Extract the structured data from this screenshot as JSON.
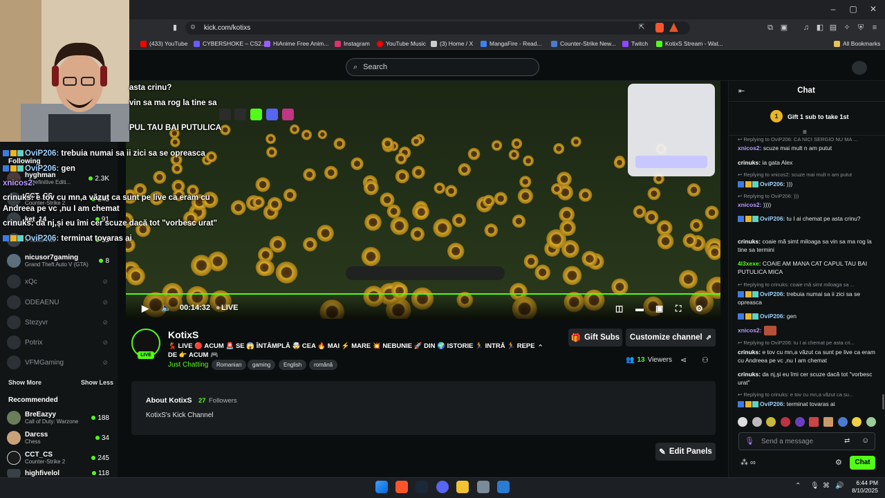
{
  "browser": {
    "url": "kick.com/kotixs",
    "bookmarks": [
      {
        "label": "(433) YouTube",
        "color": "#ff0000"
      },
      {
        "label": "CYBERSHOKE – CS2...",
        "color": "#6a5cff"
      },
      {
        "label": "HiAnime Free Anim...",
        "color": "#9b5cff"
      },
      {
        "label": "Instagram",
        "color": "#e1306c"
      },
      {
        "label": "YouTube Music",
        "color": "#ff0000"
      },
      {
        "label": "(3) Home / X",
        "color": "#cccccc"
      },
      {
        "label": "MangaFire - Read...",
        "color": "#3b82f6"
      },
      {
        "label": "Counter-Strike New...",
        "color": "#4a7bd1"
      },
      {
        "label": "Twitch",
        "color": "#9146ff"
      },
      {
        "label": "KotixS Stream - Wat...",
        "color": "#53fc18"
      }
    ],
    "all_bookmarks": "All Bookmarks"
  },
  "kick": {
    "search_placeholder": "Search"
  },
  "sidebar": {
    "following_label": "Following",
    "following": [
      {
        "name": "hyghman",
        "game": "... Definitive Editi...",
        "count": "2.3K",
        "live": true
      },
      {
        "name": "CCT_CS",
        "game": "Counter-Strike 2",
        "count": "245",
        "live": true
      },
      {
        "name": "ket_14",
        "game": "",
        "count": "91",
        "live": true
      },
      {
        "name": "",
        "game": "It Takes Two",
        "count": "53",
        "live": true
      },
      {
        "name": "nicusor7gaming",
        "game": "Grand Theft Auto V (GTA)",
        "count": "8",
        "live": true
      },
      {
        "name": "xQc",
        "game": "",
        "count": "",
        "live": false
      },
      {
        "name": "ODEAENU",
        "game": "",
        "count": "",
        "live": false
      },
      {
        "name": "Stezyvr",
        "game": "",
        "count": "",
        "live": false
      },
      {
        "name": "Potrix",
        "game": "",
        "count": "",
        "live": false
      },
      {
        "name": "VFMGaming",
        "game": "",
        "count": "",
        "live": false
      }
    ],
    "show_more": "Show More",
    "show_less": "Show Less",
    "recommended_label": "Recommended",
    "recommended": [
      {
        "name": "BreEazyy",
        "game": "Call of Duty: Warzone",
        "count": "188"
      },
      {
        "name": "Darcss",
        "game": "Chess",
        "count": "34"
      },
      {
        "name": "CCT_CS",
        "game": "Counter-Strike 2",
        "count": "245"
      },
      {
        "name": "highfivelol",
        "game": "",
        "count": "118"
      }
    ]
  },
  "overlay_chat": [
    {
      "user": "",
      "text": "asta crinu?"
    },
    {
      "user": "",
      "text": "vin sa ma rog la tine sa"
    },
    {
      "user": "",
      "text": "PUL TAU BAI PUTULICA"
    },
    {
      "user": "OviP206:",
      "text": " trebuia numai sa ii zici sa se opreasca"
    },
    {
      "user": "OviP206:",
      "text": " gen"
    },
    {
      "user": "xnicos2:",
      "text": ""
    },
    {
      "user": "crinuks:",
      "text": " e tov cu mn,a văzut ca sunt pe live ca eram cu"
    },
    {
      "user": "",
      "text": "Andreea pe vc ,nu I am chemat"
    },
    {
      "user": "crinuks:",
      "text": " da nj,și eu îmi cer scuze dacă tot \"vorbesc urat\""
    },
    {
      "user": "OviP206:",
      "text": " terminat tovaras ai"
    }
  ],
  "player": {
    "time": "00:14:32",
    "live_label": "LIVE",
    "progress": 1.0
  },
  "stream": {
    "streamer": "KotixS",
    "live_badge": "LIVE",
    "title": "💃 LIVE 🔴 ACUM 🚨 SE 😱 ÎNTÂMPLĂ 🤯 CEA 🔥 MAI ⚡ MARE 💥 NEBUNIE 🚀 DIN 🌍 ISTORIE 🏃 INTRĂ 🏃 REPE DE 👉 ACUM 🎮",
    "category": "Just Chatting",
    "tags": [
      "Romanian",
      "gaming",
      "English",
      "română"
    ],
    "gift_subs": "Gift Subs",
    "customize": "Customize channel",
    "viewers_count": "13",
    "viewers_label": "Viewers",
    "about_title": "About KotixS",
    "followers_count": "27",
    "followers_label": "Followers",
    "about_text": "KotixS's Kick Channel",
    "edit_panels": "Edit Panels"
  },
  "chat": {
    "title": "Chat",
    "gift_banner": "Gift 1 sub to take 1st",
    "gift_rank": "1",
    "messages": [
      {
        "reply": "Replying to OviP206: CA NICI SERGIO NU MA ...",
        "user": "xnicos2:",
        "user_color": "#b89cff",
        "badges": false,
        "text": " scuze mai mult n am putut"
      },
      {
        "reply": "",
        "user": "crinuks:",
        "user_color": "#ffffff",
        "badges": false,
        "text": " ia gata Alex"
      },
      {
        "reply": "Replying to xnicos2: scuze mai mult n am putut",
        "user": "OviP206:",
        "user_color": "#9fd3ff",
        "badges": true,
        "text": " )))"
      },
      {
        "reply": "Replying to OviP206: )))",
        "user": "xnicos2:",
        "user_color": "#b89cff",
        "badges": false,
        "text": " ))))"
      },
      {
        "reply": "",
        "user": "OviP206:",
        "user_color": "#9fd3ff",
        "badges": true,
        "text": " tu I ai chemat pe asta crinu?"
      },
      {
        "reply": "",
        "user": "crinuks:",
        "user_color": "#ffffff",
        "badges": false,
        "text": " coaie mă simt miloaga sa vin sa ma rog la tine sa termini"
      },
      {
        "reply": "",
        "user": "4l3xexe:",
        "user_color": "#53fc18",
        "badges": false,
        "text": " COAIE AM MANA CAT CAPUL TAU BAI PUTULICA MICA"
      },
      {
        "reply": "Replying to crinuks: coaie mă simt miloaga sa ...",
        "user": "OviP206:",
        "user_color": "#9fd3ff",
        "badges": true,
        "text": " trebuia numai sa ii zici sa se opreasca"
      },
      {
        "reply": "",
        "user": "OviP206:",
        "user_color": "#9fd3ff",
        "badges": true,
        "text": " gen"
      },
      {
        "reply": "",
        "user": "xnicos2:",
        "user_color": "#b89cff",
        "badges": false,
        "text": ""
      },
      {
        "reply": "Replying to OviP206: tu I ai chemat pe asta cri...",
        "user": "crinuks:",
        "user_color": "#ffffff",
        "badges": false,
        "text": " e tov cu mn,a văzut ca sunt pe live ca eram cu Andreea pe vc ,nu I am chemat"
      },
      {
        "reply": "",
        "user": "crinuks:",
        "user_color": "#ffffff",
        "badges": false,
        "text": " da nj,și eu îmi cer scuze dacă tot \"vorbesc urat\""
      },
      {
        "reply": "Replying to crinuks: e tov cu mn,a văzut ca su...",
        "user": "OviP206:",
        "user_color": "#9fd3ff",
        "badges": true,
        "text": " terminat tovaras ai"
      }
    ],
    "input_placeholder": "Send a message",
    "send_label": "Chat",
    "colors": {
      "accent": "#53fc18"
    }
  },
  "taskbar": {
    "time": "6:44 PM",
    "date": "8/10/2025"
  }
}
